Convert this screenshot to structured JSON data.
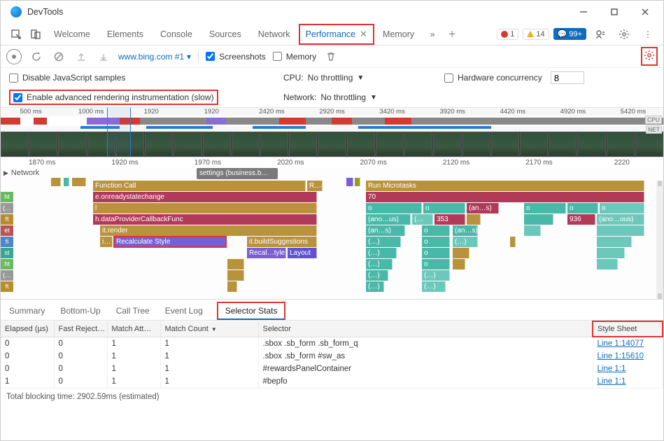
{
  "window": {
    "title": "DevTools"
  },
  "tabs": {
    "items": [
      "Welcome",
      "Elements",
      "Console",
      "Sources",
      "Network",
      "Performance",
      "Memory"
    ],
    "active": "Performance"
  },
  "badges": {
    "errors": "1",
    "warnings": "14",
    "messages": "99+"
  },
  "perf_toolbar": {
    "url": "www.bing.com #1",
    "screenshots_label": "Screenshots",
    "memory_label": "Memory"
  },
  "settings": {
    "disable_js_label": "Disable JavaScript samples",
    "adv_render_label": "Enable advanced rendering instrumentation (slow)",
    "cpu_label": "CPU:",
    "cpu_value": "No throttling",
    "network_label": "Network:",
    "network_value": "No throttling",
    "hw_conc_label": "Hardware concurrency",
    "hw_conc_value": "8"
  },
  "overview_ticks": [
    "500 ms",
    "1000 ms",
    "",
    "1920",
    "",
    "1920",
    "",
    "2420 ms",
    "",
    "2920 ms",
    "",
    "3420 ms",
    "",
    "3920 ms",
    "",
    "4420 ms",
    "",
    "4920 ms",
    "",
    "5420 ms"
  ],
  "overview_labels": {
    "cpu": "CPU",
    "net": "NET"
  },
  "detail_ticks": [
    "1870 ms",
    "1920 ms",
    "1970 ms",
    "2020 ms",
    "2070 ms",
    "2120 ms",
    "2170 ms",
    "2220 "
  ],
  "flame": {
    "network_label": "Network",
    "settings_pill": "settings (business.b…",
    "row_labels": [
      "ht",
      "(…",
      "ft",
      "et",
      "fi",
      "st",
      "ht",
      "(…",
      "ft"
    ],
    "l": {
      "fc": "Function Call",
      "rs": "R…s",
      "eors": "e.onreadystatechange",
      "l": "l",
      "hdata": "h.dataProviderCallbackFunc",
      "itr": "it.render",
      "i": "i…",
      "recalc": "Recalculate Style",
      "itb": "it.buildSuggestions",
      "recal2": "Recal…tyle",
      "layout": "Layout"
    },
    "r": {
      "run": "Run Microtasks",
      "n70": "70",
      "o": "o",
      "an": "(an…s)",
      "anous": "(ano…us)",
      "anoous": "(ano…ous)",
      "p": "(…",
      "n353": "353",
      "n936": "936",
      "dots": "(…)"
    }
  },
  "bottom_tabs": [
    "Summary",
    "Bottom-Up",
    "Call Tree",
    "Event Log",
    "Selector Stats"
  ],
  "table": {
    "headers": [
      "Elapsed (µs)",
      "Fast Reject…",
      "Match Att…",
      "Match Count",
      "Selector",
      "Style Sheet"
    ],
    "rows": [
      {
        "elapsed": "0",
        "reject": "0",
        "att": "1",
        "count": "1",
        "selector": ".sbox .sb_form .sb_form_q",
        "sheet": "Line 1:14077"
      },
      {
        "elapsed": "0",
        "reject": "0",
        "att": "1",
        "count": "1",
        "selector": ".sbox .sb_form #sw_as",
        "sheet": "Line 1:15610"
      },
      {
        "elapsed": "0",
        "reject": "0",
        "att": "1",
        "count": "1",
        "selector": "#rewardsPanelContainer",
        "sheet": "Line 1:1"
      },
      {
        "elapsed": "1",
        "reject": "0",
        "att": "1",
        "count": "1",
        "selector": "#bepfo",
        "sheet": "Line 1:1"
      }
    ]
  },
  "footer": "Total blocking time: 2902.59ms (estimated)"
}
